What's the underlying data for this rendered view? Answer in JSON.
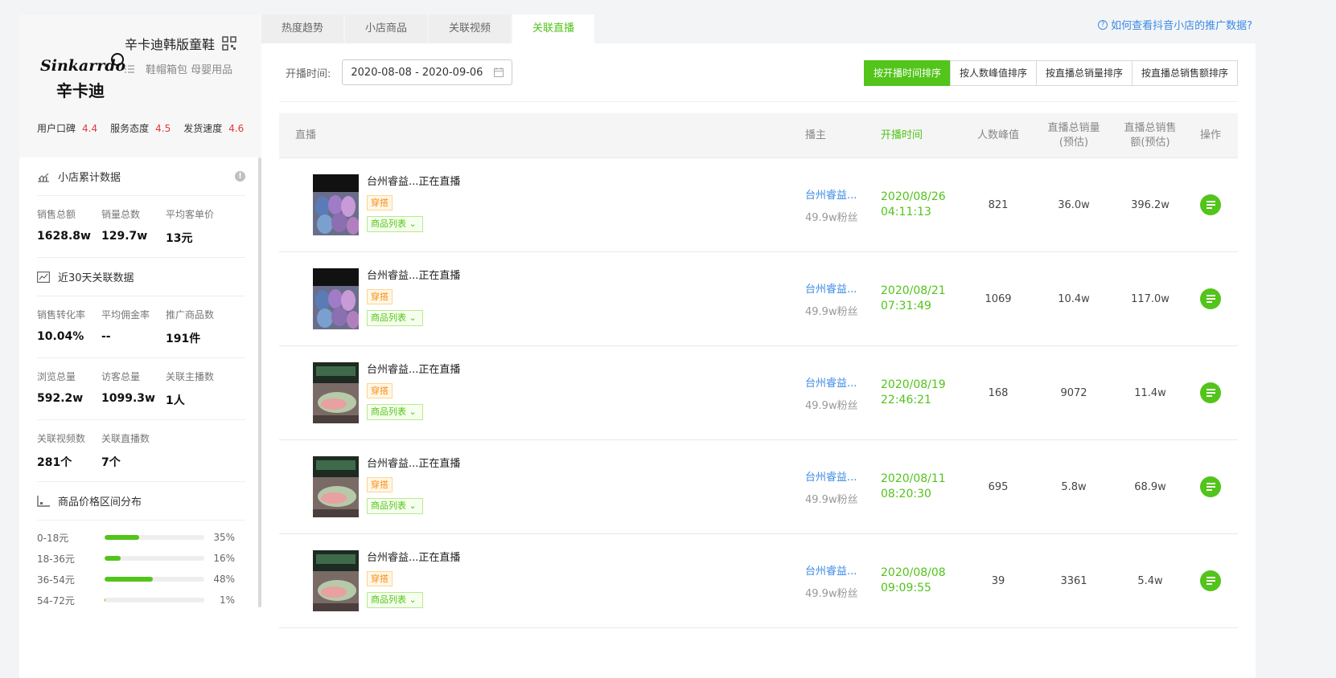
{
  "shop": {
    "name": "辛卡迪韩版童鞋",
    "category": "鞋帽箱包 母婴用品",
    "logo_text_top": "Sinkarrdo",
    "logo_text_bottom": "辛卡迪",
    "ratings": [
      {
        "label": "用户口碑",
        "value": "4.4"
      },
      {
        "label": "服务态度",
        "value": "4.5"
      },
      {
        "label": "发货速度",
        "value": "4.6"
      }
    ]
  },
  "cumulative": {
    "title": "小店累计数据",
    "stats": [
      {
        "label": "销售总额",
        "value": "1628.8w"
      },
      {
        "label": "销量总数",
        "value": "129.7w"
      },
      {
        "label": "平均客单价",
        "value": "13元"
      }
    ]
  },
  "recent30": {
    "title": "近30天关联数据",
    "rows": [
      [
        {
          "label": "销售转化率",
          "value": "10.04%"
        },
        {
          "label": "平均佣金率",
          "value": "--"
        },
        {
          "label": "推广商品数",
          "value": "191件"
        }
      ],
      [
        {
          "label": "浏览总量",
          "value": "592.2w"
        },
        {
          "label": "访客总量",
          "value": "1099.3w"
        },
        {
          "label": "关联主播数",
          "value": "1人"
        }
      ],
      [
        {
          "label": "关联视频数",
          "value": "281个"
        },
        {
          "label": "关联直播数",
          "value": "7个"
        }
      ]
    ]
  },
  "price_dist": {
    "title": "商品价格区间分布",
    "items": [
      {
        "range": "0-18元",
        "pct": "35%",
        "fraction": 0.35
      },
      {
        "range": "18-36元",
        "pct": "16%",
        "fraction": 0.16
      },
      {
        "range": "36-54元",
        "pct": "48%",
        "fraction": 0.48
      },
      {
        "range": "54-72元",
        "pct": "1%",
        "fraction": 0.01
      }
    ]
  },
  "tabs": [
    "热度趋势",
    "小店商品",
    "关联视频",
    "关联直播"
  ],
  "active_tab": 3,
  "help_link": "如何查看抖音小店的推广数据?",
  "filter": {
    "label": "开播时间:",
    "date_range": "2020-08-08 - 2020-09-06"
  },
  "sort_buttons": [
    "按开播时间排序",
    "按人数峰值排序",
    "按直播总销量排序",
    "按直播总销售额排序"
  ],
  "active_sort": 0,
  "table": {
    "headers": {
      "live": "直播",
      "anchor": "播主",
      "time": "开播时间",
      "peak": "人数峰值",
      "sales_1": "直播总销量",
      "sales_2": "(预估)",
      "amount_1": "直播总销售",
      "amount_2": "额(预估)",
      "op": "操作"
    },
    "rows": [
      {
        "title": "台州睿益...正在直播",
        "tag": "穿搭",
        "goods": "商品列表",
        "anchor": "台州睿益...",
        "fans": "49.9w粉丝",
        "date": "2020/08/26",
        "clock": "04:11:13",
        "peak": "821",
        "sales": "36.0w",
        "amount": "396.2w",
        "thumb": "hair"
      },
      {
        "title": "台州睿益...正在直播",
        "tag": "穿搭",
        "goods": "商品列表",
        "anchor": "台州睿益...",
        "fans": "49.9w粉丝",
        "date": "2020/08/21",
        "clock": "07:31:49",
        "peak": "1069",
        "sales": "10.4w",
        "amount": "117.0w",
        "thumb": "hair"
      },
      {
        "title": "台州睿益...正在直播",
        "tag": "穿搭",
        "goods": "商品列表",
        "anchor": "台州睿益...",
        "fans": "49.9w粉丝",
        "date": "2020/08/19",
        "clock": "22:46:21",
        "peak": "168",
        "sales": "9072",
        "amount": "11.4w",
        "thumb": "shoe"
      },
      {
        "title": "台州睿益...正在直播",
        "tag": "穿搭",
        "goods": "商品列表",
        "anchor": "台州睿益...",
        "fans": "49.9w粉丝",
        "date": "2020/08/11",
        "clock": "08:20:30",
        "peak": "695",
        "sales": "5.8w",
        "amount": "68.9w",
        "thumb": "shoe"
      },
      {
        "title": "台州睿益...正在直播",
        "tag": "穿搭",
        "goods": "商品列表",
        "anchor": "台州睿益...",
        "fans": "49.9w粉丝",
        "date": "2020/08/08",
        "clock": "09:09:55",
        "peak": "39",
        "sales": "3361",
        "amount": "5.4w",
        "thumb": "shoe"
      }
    ]
  },
  "colors": {
    "accent": "#52c41a",
    "link": "#3c8ae6",
    "rating": "#e4393c",
    "tag": "#fa8c16"
  }
}
